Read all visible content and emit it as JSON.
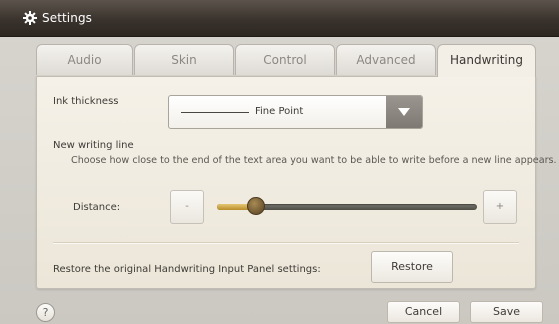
{
  "window": {
    "title": "Settings",
    "icon": "gear-icon"
  },
  "tabs": [
    {
      "label": "Audio",
      "active": false
    },
    {
      "label": "Skin",
      "active": false
    },
    {
      "label": "Control",
      "active": false
    },
    {
      "label": "Advanced",
      "active": false
    },
    {
      "label": "Handwriting",
      "active": true
    }
  ],
  "handwriting": {
    "ink_thickness_label": "Ink thickness",
    "ink_thickness_value": "Fine Point",
    "new_line_heading": "New writing line",
    "new_line_description": "Choose how close to the end of the text area you want to be able to write before a new line appears.",
    "distance_label": "Distance:",
    "decrease_label": "-",
    "increase_label": "+",
    "distance_level": 0.15,
    "restore_text": "Restore the original Handwriting Input Panel settings:",
    "restore_button": "Restore"
  },
  "footer": {
    "help_label": "?",
    "cancel_label": "Cancel",
    "save_label": "Save"
  },
  "colors": {
    "titlebar": "#3a332d",
    "panel": "#f3efe6",
    "slider_fill": "#d9b454"
  }
}
